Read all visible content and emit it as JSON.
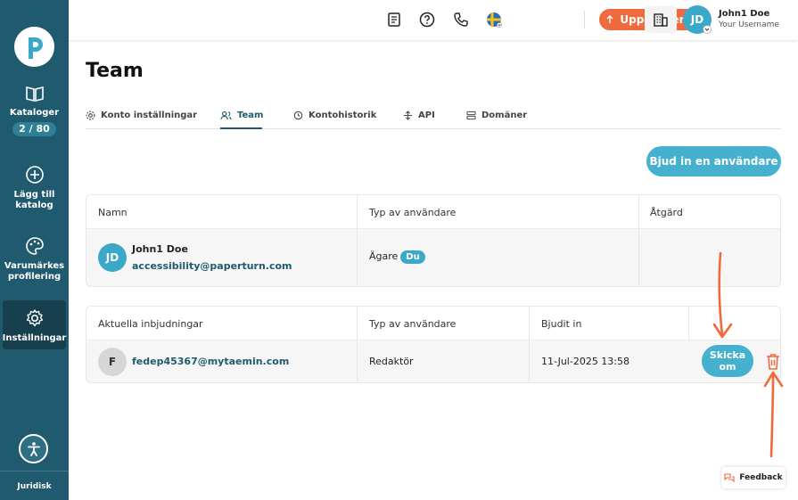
{
  "sidebar": {
    "catalogs_label": "Kataloger",
    "catalogs_count": "2 / 80",
    "add_catalog_label": "Lägg till katalog",
    "branding_label": "Varumärkes profilering",
    "settings_label": "Inställningar",
    "legal_label": "Juridisk"
  },
  "topbar": {
    "upgrade_label": "Uppgradera",
    "avatar_initials": "JD",
    "user_name": "John1 Doe",
    "user_sub": "Your Username"
  },
  "page": {
    "title": "Team",
    "tabs": [
      {
        "label": "Konto inställningar"
      },
      {
        "label": "Team"
      },
      {
        "label": "Kontohistorik"
      },
      {
        "label": "API"
      },
      {
        "label": "Domäner"
      }
    ],
    "invite_button": "Bjud in en användare"
  },
  "team_table": {
    "headers": [
      "Namn",
      "Typ av användare",
      "Åtgärd"
    ],
    "row": {
      "initials": "JD",
      "name": "John1 Doe",
      "email": "accessibility@paperturn.com",
      "type": "Ägare",
      "badge": "Du"
    }
  },
  "invites_table": {
    "headers": [
      "Aktuella inbjudningar",
      "Typ av användare",
      "Bjudit in"
    ],
    "row": {
      "initials": "F",
      "email": "fedep45367@mytaemin.com",
      "type": "Redaktör",
      "invited": "11-Jul-2025 13:58",
      "resend_label": "Skicka om"
    }
  },
  "feedback_label": "Feedback",
  "colors": {
    "sidebar": "#1f5a6e",
    "accent": "#46b1cf",
    "upgrade": "#ef6a3c",
    "annotation": "#ef6a3c"
  }
}
